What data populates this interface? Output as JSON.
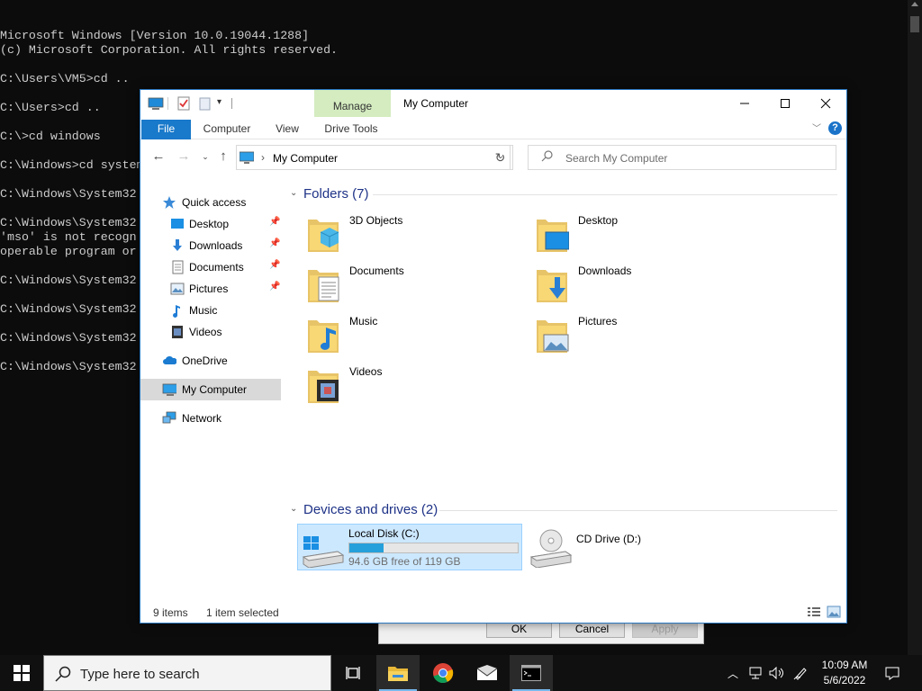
{
  "console": {
    "lines": [
      "Microsoft Windows [Version 10.0.19044.1288]",
      "(c) Microsoft Corporation. All rights reserved.",
      "",
      "C:\\Users\\VM5>cd ..",
      "",
      "C:\\Users>cd ..",
      "",
      "C:\\>cd windows",
      "",
      "C:\\Windows>cd system",
      "",
      "C:\\Windows\\System32",
      "",
      "C:\\Windows\\System32",
      "'mso' is not recogn",
      "operable program or",
      "",
      "C:\\Windows\\System32",
      "",
      "C:\\Windows\\System32",
      "",
      "C:\\Windows\\System32",
      "",
      "C:\\Windows\\System32"
    ]
  },
  "dialog": {
    "ok": "OK",
    "cancel": "Cancel",
    "apply": "Apply"
  },
  "explorer": {
    "title": "My Computer",
    "manage_tab": "Manage",
    "ribbon_tabs": [
      "File",
      "Computer",
      "View",
      "Drive Tools"
    ],
    "address": "My Computer",
    "search_placeholder": "Search My Computer",
    "nav": {
      "quick_access": "Quick access",
      "desktop": "Desktop",
      "downloads": "Downloads",
      "documents": "Documents",
      "pictures": "Pictures",
      "music": "Music",
      "videos": "Videos",
      "onedrive": "OneDrive",
      "my_computer": "My Computer",
      "network": "Network"
    },
    "folders_header": "Folders (7)",
    "folders": [
      "3D Objects",
      "Desktop",
      "Documents",
      "Downloads",
      "Music",
      "Pictures",
      "Videos"
    ],
    "devices_header": "Devices and drives (2)",
    "drives": [
      {
        "name": "Local Disk (C:)",
        "free": "94.6 GB free of 119 GB",
        "used_fraction": 0.205
      },
      {
        "name": "CD Drive (D:)"
      }
    ],
    "status": {
      "items": "9 items",
      "selected": "1 item selected"
    }
  },
  "taskbar": {
    "search_placeholder": "Type here to search",
    "time": "10:09 AM",
    "date": "5/6/2022"
  }
}
